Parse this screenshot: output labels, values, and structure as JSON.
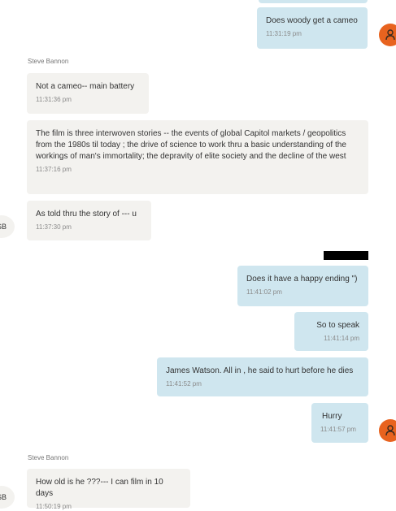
{
  "colors": {
    "outgoing_bubble": "#cfe6ef",
    "incoming_bubble": "#f3f2ef",
    "user_avatar": "#e8631f",
    "redaction": "#000000"
  },
  "contact": {
    "name": "Steve Bannon",
    "initials": "SB"
  },
  "user_avatar_icon": "person-outline-icon",
  "messages": [
    {
      "direction": "outgoing",
      "text": "Does woody get a cameo",
      "time": "11:31:19 pm"
    },
    {
      "direction": "incoming",
      "text": "Not a cameo-- main battery",
      "time": "11:31:36 pm"
    },
    {
      "direction": "incoming",
      "text": "The film is three interwoven stories -- the events of global Capitol markets / geopolitics from the 1980s til today ; the drive of science to work thru a basic understanding of the workings of man's immortality; the depravity of elite society and the decline of the west",
      "time": "11:37:16 pm"
    },
    {
      "direction": "incoming",
      "text": "As told thru the story of --- u",
      "time": "11:37:30 pm"
    },
    {
      "direction": "outgoing",
      "text": "Does it have a happy ending \")",
      "time": "11:41:02 pm"
    },
    {
      "direction": "outgoing",
      "text": "So to speak",
      "time": "11:41:14 pm"
    },
    {
      "direction": "outgoing",
      "text": "James Watson. All in ,  he said to hurt before he dies",
      "time": "11:41:52 pm"
    },
    {
      "direction": "outgoing",
      "text": "Hurry",
      "time": "11:41:57 pm"
    },
    {
      "direction": "incoming",
      "text": "How old is he ???--- I can film in 10 days",
      "time": "11:50:19 pm"
    }
  ]
}
